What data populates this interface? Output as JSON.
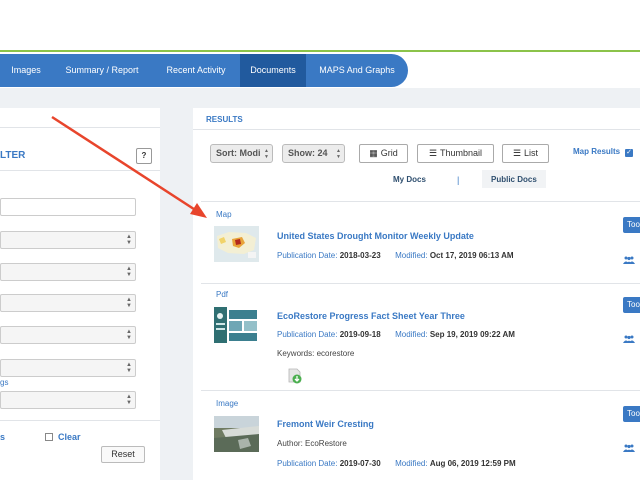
{
  "nav": {
    "tabs": [
      {
        "label": "Images"
      },
      {
        "label": "Summary / Report"
      },
      {
        "label": "Recent Activity"
      },
      {
        "label": "Documents"
      },
      {
        "label": "MAPS And Graphs"
      }
    ],
    "active_tab": "Documents"
  },
  "filter_panel": {
    "title": "LTER",
    "help_label": "?",
    "partial_link": "gs",
    "partial_s": "s",
    "clear_label": "Clear",
    "reset_label": "Reset"
  },
  "results": {
    "heading": "RESULTS",
    "sort_value": "Sort: Modi",
    "show_value": "Show: 24",
    "grid_label": "Grid",
    "thumbnail_label": "Thumbnail",
    "list_label": "List",
    "map_results_label": "Map Results",
    "my_docs_label": "My Docs",
    "docs_separator": "|",
    "public_docs_label": "Public Docs",
    "tool_button_label": "Too",
    "items": [
      {
        "type": "Map",
        "title": "United States Drought Monitor Weekly Update",
        "pub_label": "Publication Date:",
        "pub_date": "2018-03-23",
        "mod_label": "Modified:",
        "mod_date": "Oct 17, 2019 06:13 AM"
      },
      {
        "type": "Pdf",
        "title": "EcoRestore Progress Fact Sheet Year Three",
        "pub_label": "Publication Date:",
        "pub_date": "2019-09-18",
        "mod_label": "Modified:",
        "mod_date": "Sep 19, 2019 09:22 AM",
        "keywords": "Keywords: ecorestore"
      },
      {
        "type": "Image",
        "title": "Fremont Weir Cresting",
        "author": "Author: EcoRestore",
        "pub_label": "Publication Date:",
        "pub_date": "2019-07-30",
        "mod_label": "Modified:",
        "mod_date": "Aug 06, 2019 12:59 PM"
      }
    ]
  },
  "colors": {
    "nav_blue": "#3a79c4",
    "nav_active": "#215a9e",
    "accent_green": "#8bc34a",
    "annotation_arrow": "#e8452c"
  }
}
